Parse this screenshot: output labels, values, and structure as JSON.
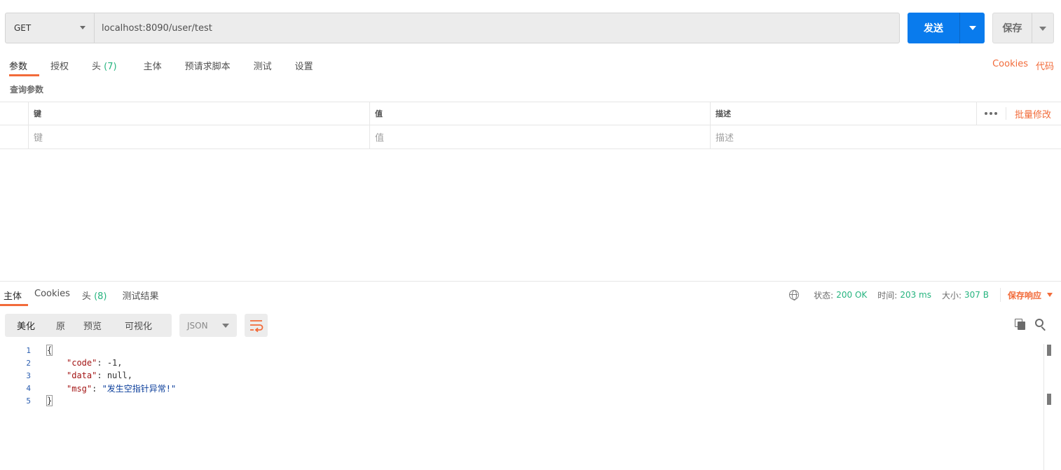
{
  "request": {
    "method": "GET",
    "url": "localhost:8090/user/test",
    "send_label": "发送",
    "save_label": "保存"
  },
  "req_tabs": [
    {
      "label": "参数",
      "active": true
    },
    {
      "label": "授权"
    },
    {
      "label": "头",
      "count": "(7)"
    },
    {
      "label": "主体"
    },
    {
      "label": "预请求脚本"
    },
    {
      "label": "测试"
    },
    {
      "label": "设置"
    }
  ],
  "req_links": {
    "cookies": "Cookies",
    "code": "代码"
  },
  "params": {
    "section_label": "查询参数",
    "headers": {
      "key": "键",
      "value": "值",
      "desc": "描述",
      "bulk_edit": "批量修改"
    },
    "placeholders": {
      "key": "键",
      "value": "值",
      "desc": "描述"
    }
  },
  "resp_tabs": [
    {
      "label": "主体",
      "active": true
    },
    {
      "label": "Cookies"
    },
    {
      "label": "头",
      "count": "(8)"
    },
    {
      "label": "测试结果"
    }
  ],
  "resp_status": {
    "status_label": "状态:",
    "status_value": "200 OK",
    "time_label": "时间:",
    "time_value": "203 ms",
    "size_label": "大小:",
    "size_value": "307 B",
    "save_response": "保存响应"
  },
  "view_modes": [
    {
      "label": "美化",
      "active": true
    },
    {
      "label": "原"
    },
    {
      "label": "预览"
    },
    {
      "label": "可视化"
    }
  ],
  "format": "JSON",
  "code_lines": [
    {
      "ln": "1",
      "text": "{"
    },
    {
      "ln": "2",
      "key": "\"code\"",
      "value": "-1",
      "type": "n"
    },
    {
      "ln": "3",
      "key": "\"data\"",
      "value": "null",
      "type": "n"
    },
    {
      "ln": "4",
      "key": "\"msg\"",
      "value": "\"发生空指针异常!\"",
      "type": "s"
    },
    {
      "ln": "5",
      "text": "}"
    }
  ],
  "colors": {
    "accent": "#f26b3a",
    "send": "#097bed",
    "ok": "#26b47f"
  }
}
